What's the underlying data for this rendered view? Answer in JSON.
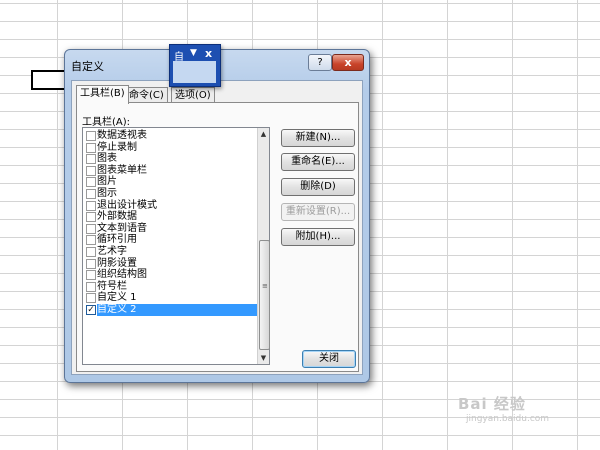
{
  "dialog": {
    "title": "自定义",
    "help_label": "?",
    "close_label": "x",
    "tabs": [
      {
        "label": "工具栏(B)",
        "active": true
      },
      {
        "label": "命令(C)",
        "active": false
      },
      {
        "label": "选项(O)",
        "active": false
      }
    ],
    "toolbars_label": "工具栏(A):",
    "toolbar_items": [
      {
        "label": "数据透视表",
        "checked": false
      },
      {
        "label": "停止录制",
        "checked": false
      },
      {
        "label": "图表",
        "checked": false
      },
      {
        "label": "图表菜单栏",
        "checked": false
      },
      {
        "label": "图片",
        "checked": false
      },
      {
        "label": "图示",
        "checked": false
      },
      {
        "label": "退出设计模式",
        "checked": false
      },
      {
        "label": "外部数据",
        "checked": false
      },
      {
        "label": "文本到语音",
        "checked": false
      },
      {
        "label": "循环引用",
        "checked": false
      },
      {
        "label": "艺术字",
        "checked": false
      },
      {
        "label": "阴影设置",
        "checked": false
      },
      {
        "label": "组织结构图",
        "checked": false
      },
      {
        "label": "符号栏",
        "checked": false
      },
      {
        "label": "自定义 1",
        "checked": false
      },
      {
        "label": "自定义 2",
        "checked": true,
        "selected": true
      }
    ],
    "buttons": {
      "new": "新建(N)...",
      "rename": "重命名(E)...",
      "delete": "删除(D)",
      "reset": "重新设置(R)...",
      "attach": "附加(H)..."
    },
    "close_button": "关闭",
    "check_mark": "✓"
  },
  "floating_toolbar": {
    "title": "自",
    "menu_arrow": "▼",
    "close": "x"
  },
  "watermark": {
    "text": "Bai 经验",
    "sub": "jingyan.baidu.com"
  },
  "colors": {
    "selection": "#3399ff",
    "floating_toolbar": "#1d4fb1",
    "close_button": "#c9432a"
  }
}
